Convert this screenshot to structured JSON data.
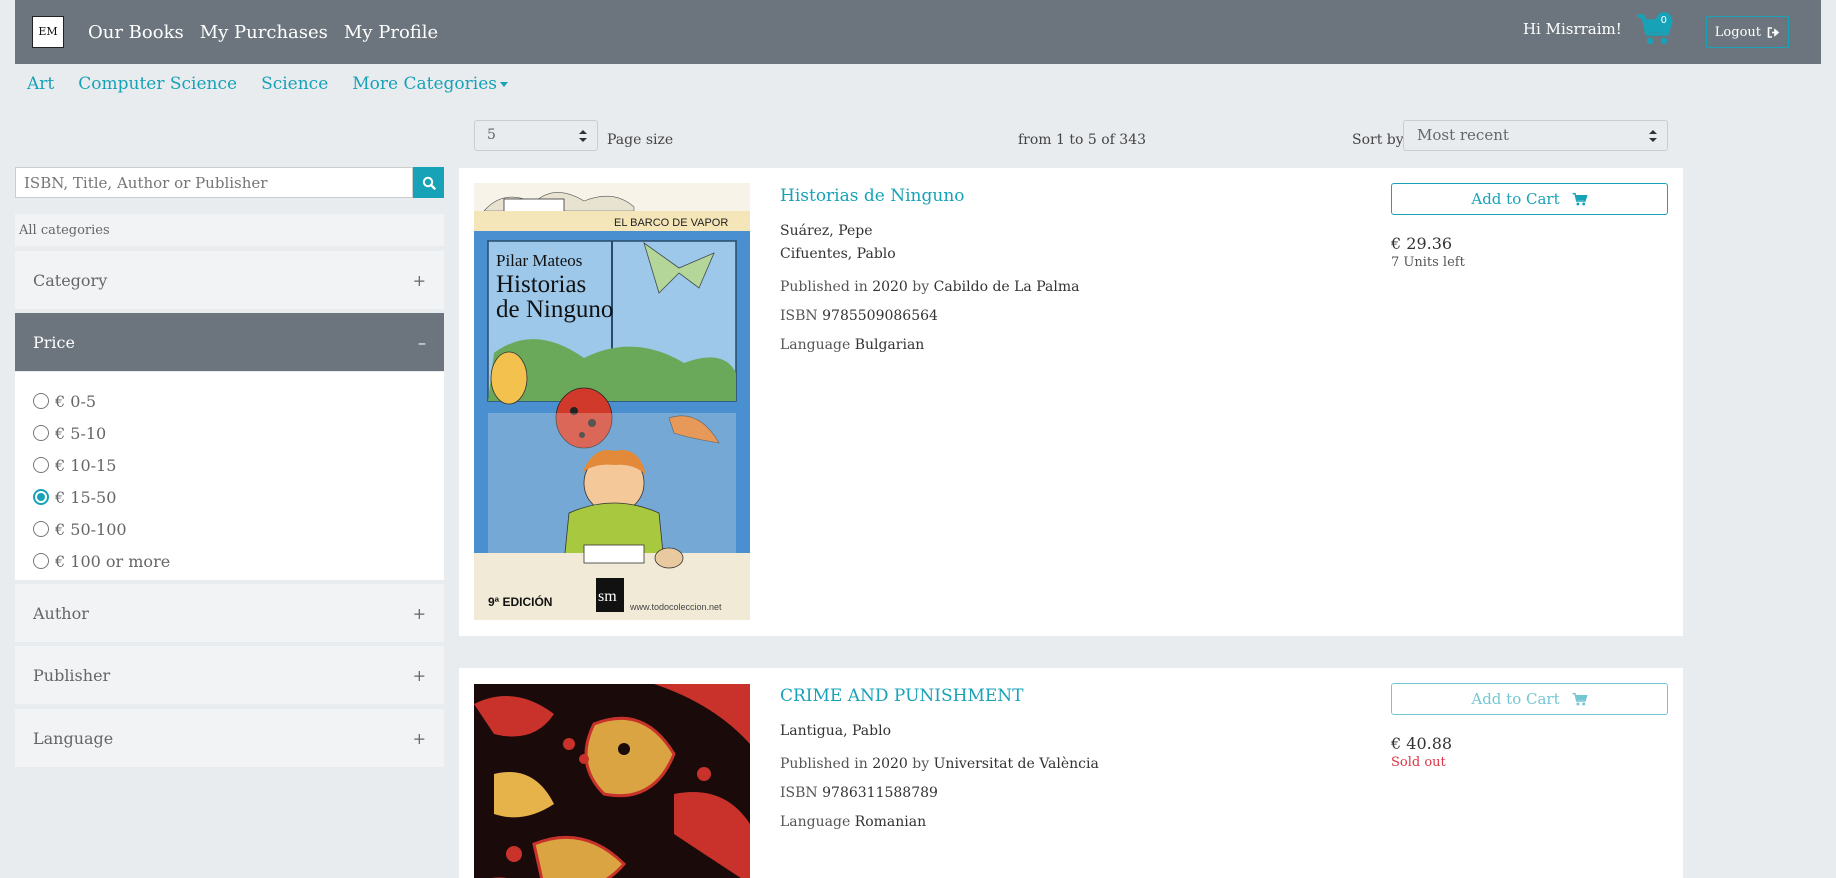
{
  "navbar": {
    "logo_text": "EM",
    "links": [
      "Our Books",
      "My Purchases",
      "My Profile"
    ],
    "greeting": "Hi Misrraim!",
    "cart_count": "0",
    "logout_label": "Logout"
  },
  "categories": {
    "items": [
      "Art",
      "Computer Science",
      "Science"
    ],
    "more_label": "More Categories"
  },
  "toolbar": {
    "page_size_value": "5",
    "page_size_label": "Page size",
    "range_text": "from 1 to 5 of 343",
    "sort_label": "Sort by",
    "sort_value": "Most recent"
  },
  "sidebar": {
    "search_placeholder": "ISBN, Title, Author or Publisher",
    "all_categories": "All categories",
    "sections": {
      "category": "Category",
      "price": "Price",
      "author": "Author",
      "publisher": "Publisher",
      "language": "Language"
    },
    "price_options": [
      "€ 0-5",
      "€ 5-10",
      "€ 10-15",
      "€ 15-50",
      "€ 50-100",
      "€ 100 or more"
    ],
    "price_selected_index": 3
  },
  "books": [
    {
      "title": "Historias de Ninguno",
      "authors": [
        "Suárez, Pepe",
        "Cifuentes, Pablo"
      ],
      "published_prefix": "Published in",
      "year": "2020",
      "by": "by",
      "publisher": "Cabildo de La Palma",
      "isbn_label": "ISBN",
      "isbn": "9785509086564",
      "language_label": "Language",
      "language": "Bulgarian",
      "add_label": "Add to Cart",
      "price": "€ 29.36",
      "stock": "7 Units left",
      "cover_text": {
        "series": "EL BARCO DE VAPOR",
        "author": "Pilar Mateos",
        "title_line1": "Historias",
        "title_line2": "de Ninguno",
        "edition": "9ª EDICIÓN",
        "watermark": "www.todocoleccion.net"
      }
    },
    {
      "title": "CRIME AND PUNISHMENT",
      "authors": [
        "Lantigua, Pablo"
      ],
      "published_prefix": "Published in",
      "year": "2020",
      "by": "by",
      "publisher": "Universitat de València",
      "isbn_label": "ISBN",
      "isbn": "9786311588789",
      "language_label": "Language",
      "language": "Romanian",
      "add_label": "Add to Cart",
      "price": "€ 40.88",
      "stock": "Sold out"
    }
  ],
  "colors": {
    "accent": "#17a2b8",
    "navbar": "#6c757d",
    "soldout": "#dc3545"
  }
}
